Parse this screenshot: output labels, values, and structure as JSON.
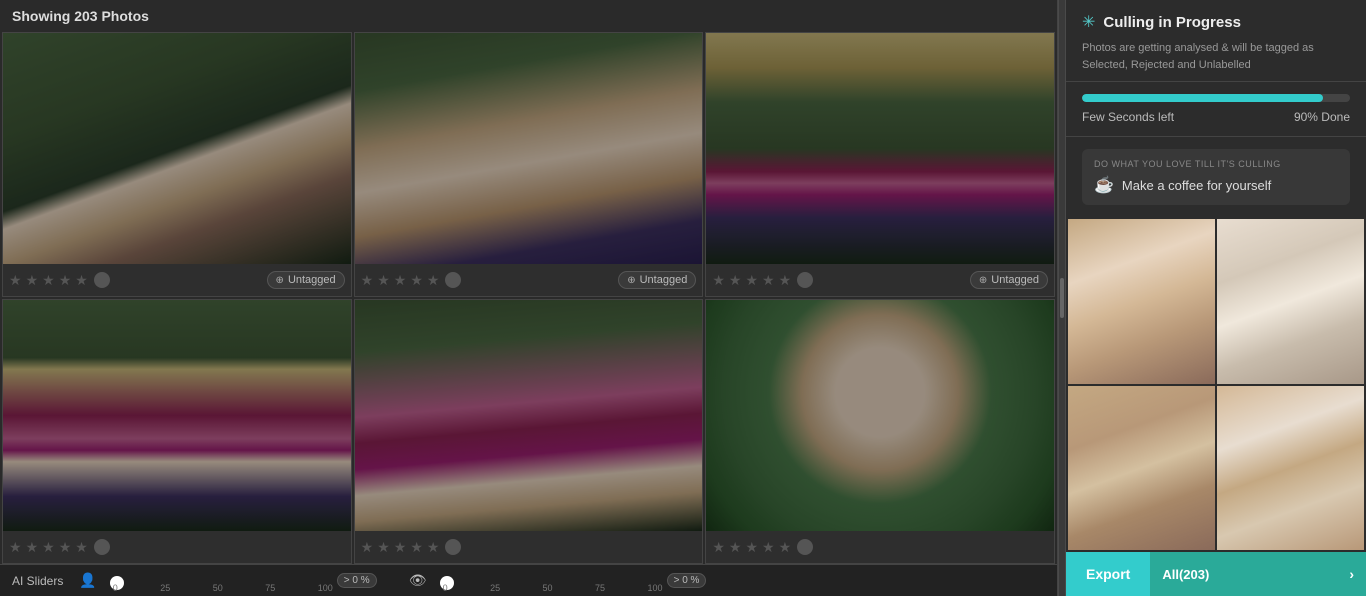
{
  "header": {
    "showing_label": "Showing 203 Photos"
  },
  "photos": [
    {
      "id": "photo-1",
      "class": "photo-couple1",
      "stars": 5,
      "tag": "Untagged"
    },
    {
      "id": "photo-2",
      "class": "photo-couple2",
      "stars": 5,
      "tag": "Untagged"
    },
    {
      "id": "photo-3",
      "class": "photo-group1",
      "stars": 5,
      "tag": "Untagged"
    },
    {
      "id": "photo-4",
      "class": "photo-group2",
      "stars": 5,
      "tag": ""
    },
    {
      "id": "photo-5",
      "class": "photo-group3",
      "stars": 5,
      "tag": ""
    },
    {
      "id": "photo-6",
      "class": "photo-bride",
      "stars": 5,
      "tag": ""
    }
  ],
  "bottom_bar": {
    "ai_sliders_label": "AI Sliders",
    "slider1": {
      "min": "0",
      "marks": [
        "0",
        "25",
        "50",
        "75",
        "100"
      ],
      "percent_badge": "> 0 %",
      "fill_percent": 0
    },
    "slider2": {
      "min": "0",
      "marks": [
        "0",
        "25",
        "50",
        "75",
        "100"
      ],
      "percent_badge": "> 0 %",
      "fill_percent": 0
    }
  },
  "right_panel": {
    "culling_title": "Culling in Progress",
    "culling_desc": "Photos are getting analysed & will be tagged as Selected, Rejected and Unlabelled",
    "progress": {
      "fill_percent": 90,
      "left_label": "Few Seconds left",
      "right_label": "90% Done"
    },
    "coffee_section": {
      "do_label": "DO WHAT YOU LOVE TILL IT'S CULLING",
      "message": "Make a coffee for yourself"
    },
    "export_bar": {
      "export_label": "Export",
      "all_label": "All(203)",
      "chevron": "›"
    }
  },
  "stars": [
    "★",
    "★",
    "★",
    "★",
    "★"
  ],
  "untagged_label": "Untagged"
}
